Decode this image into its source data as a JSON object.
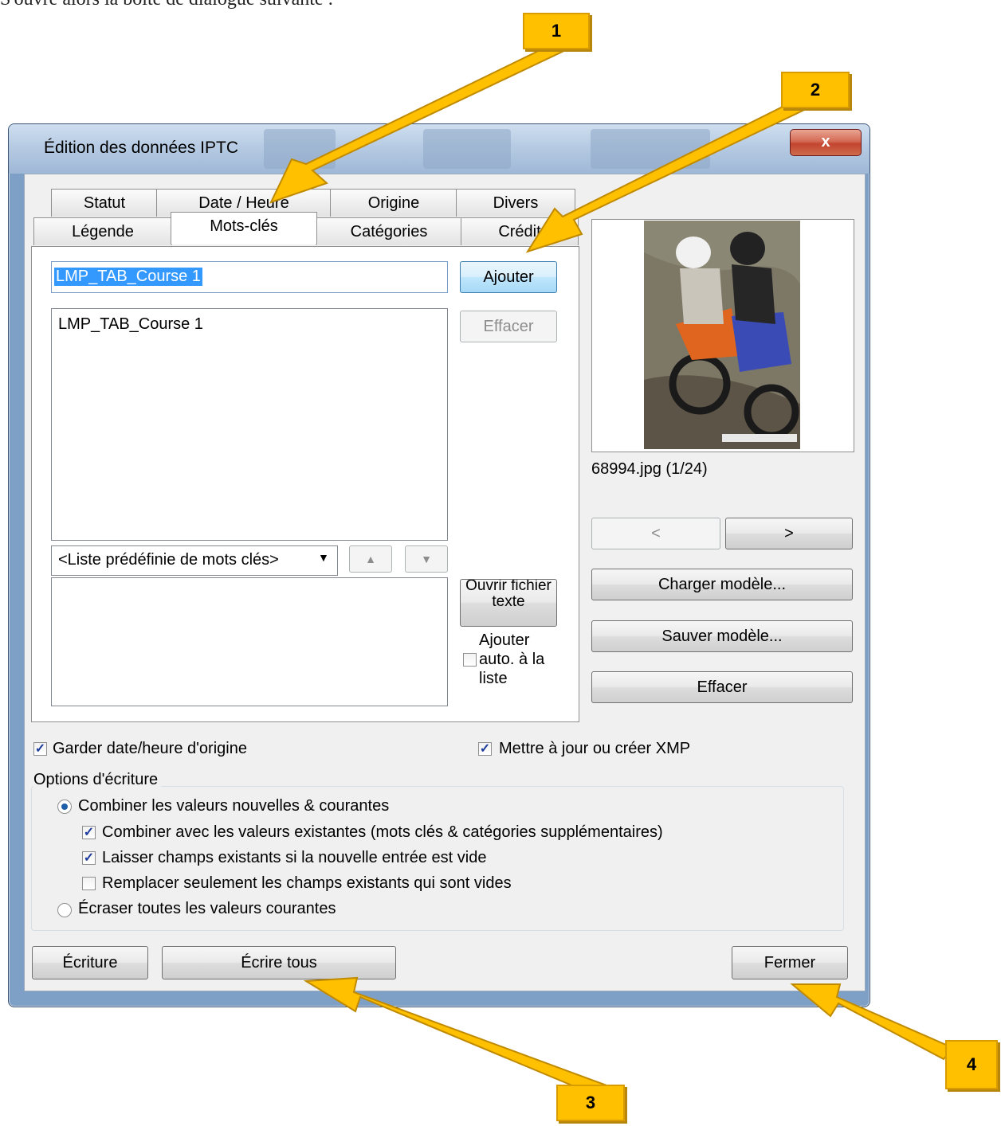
{
  "intro_text": "S'ouvre alors la boîte de dialogue suivante :",
  "window": {
    "title": "Édition des données IPTC",
    "close_label": "x"
  },
  "tabs_row1": [
    "Statut",
    "Date / Heure",
    "Origine",
    "Divers"
  ],
  "tabs_row2": [
    "Légende",
    "Mots-clés",
    "Catégories",
    "Crédit"
  ],
  "active_tab": "Mots-clés",
  "keywords": {
    "input_value": "LMP_TAB_Course 1",
    "add_button": "Ajouter",
    "list_items": [
      "LMP_TAB_Course 1"
    ],
    "clear_button": "Effacer",
    "predefined_list": "<Liste prédéfinie de mots clés>",
    "open_text_file_button": "Ouvrir fichier texte",
    "auto_add_label": "Ajouter auto. à la liste",
    "auto_add_checked": false
  },
  "preview": {
    "caption": "68994.jpg (1/24)",
    "prev_label": "<",
    "next_label": ">",
    "load_template": "Charger modèle...",
    "save_template": "Sauver modèle...",
    "clear": "Effacer"
  },
  "options": {
    "keep_date": "Garder date/heure d'origine",
    "keep_date_checked": true,
    "update_xmp": "Mettre à jour ou créer XMP",
    "update_xmp_checked": true,
    "group_title": "Options d'écriture",
    "combine_radio": "Combiner les valeurs nouvelles & courantes",
    "combine_existing": "Combiner avec les valeurs existantes (mots clés & catégories supplémentaires)",
    "combine_existing_checked": true,
    "leave_existing": "Laisser champs existants si la nouvelle entrée est vide",
    "leave_existing_checked": true,
    "replace_empty": "Remplacer seulement les champs existants qui sont vides",
    "replace_empty_checked": false,
    "overwrite_radio": "Écraser toutes les valeurs courantes",
    "selected_radio": "combine"
  },
  "footer": {
    "write": "Écriture",
    "write_all": "Écrire tous",
    "close": "Fermer"
  },
  "callouts": [
    "1",
    "2",
    "3",
    "4"
  ],
  "colors": {
    "callout": "#ffc000",
    "selection": "#3399ff",
    "close_button": "#c2452f"
  }
}
